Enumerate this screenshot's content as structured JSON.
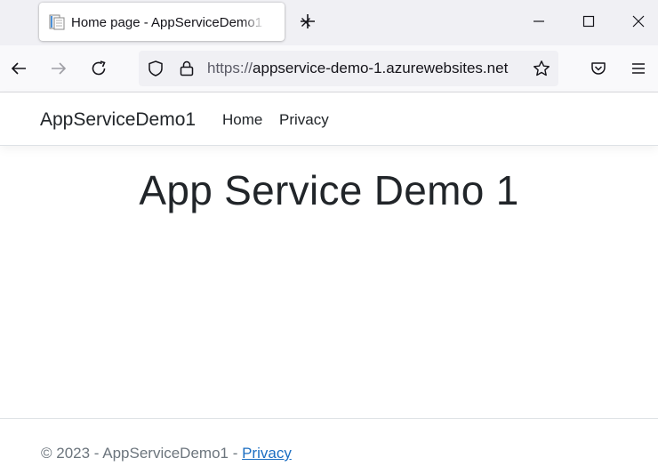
{
  "browser": {
    "tab": {
      "title": "Home page - AppServiceDemo1"
    },
    "url": {
      "scheme": "https://",
      "host": "appservice-demo-1.azurewebsites.net"
    }
  },
  "site": {
    "brand": "AppServiceDemo1",
    "nav": [
      {
        "label": "Home"
      },
      {
        "label": "Privacy"
      }
    ],
    "hero_title": "App Service Demo 1",
    "footer": {
      "text": "© 2023 - AppServiceDemo1 - ",
      "link": "Privacy"
    }
  },
  "colors": {
    "tabstrip": "#f0f0f4",
    "toolbar": "#f9f9fb",
    "footer_link": "#1b6ec2",
    "footer_text": "#6c757d"
  },
  "icons": [
    "page-icon",
    "close-icon",
    "plus-icon",
    "minimize-icon",
    "maximize-icon",
    "back-icon",
    "forward-icon",
    "reload-icon",
    "shield-icon",
    "lock-icon",
    "star-icon",
    "pocket-icon",
    "menu-icon"
  ]
}
